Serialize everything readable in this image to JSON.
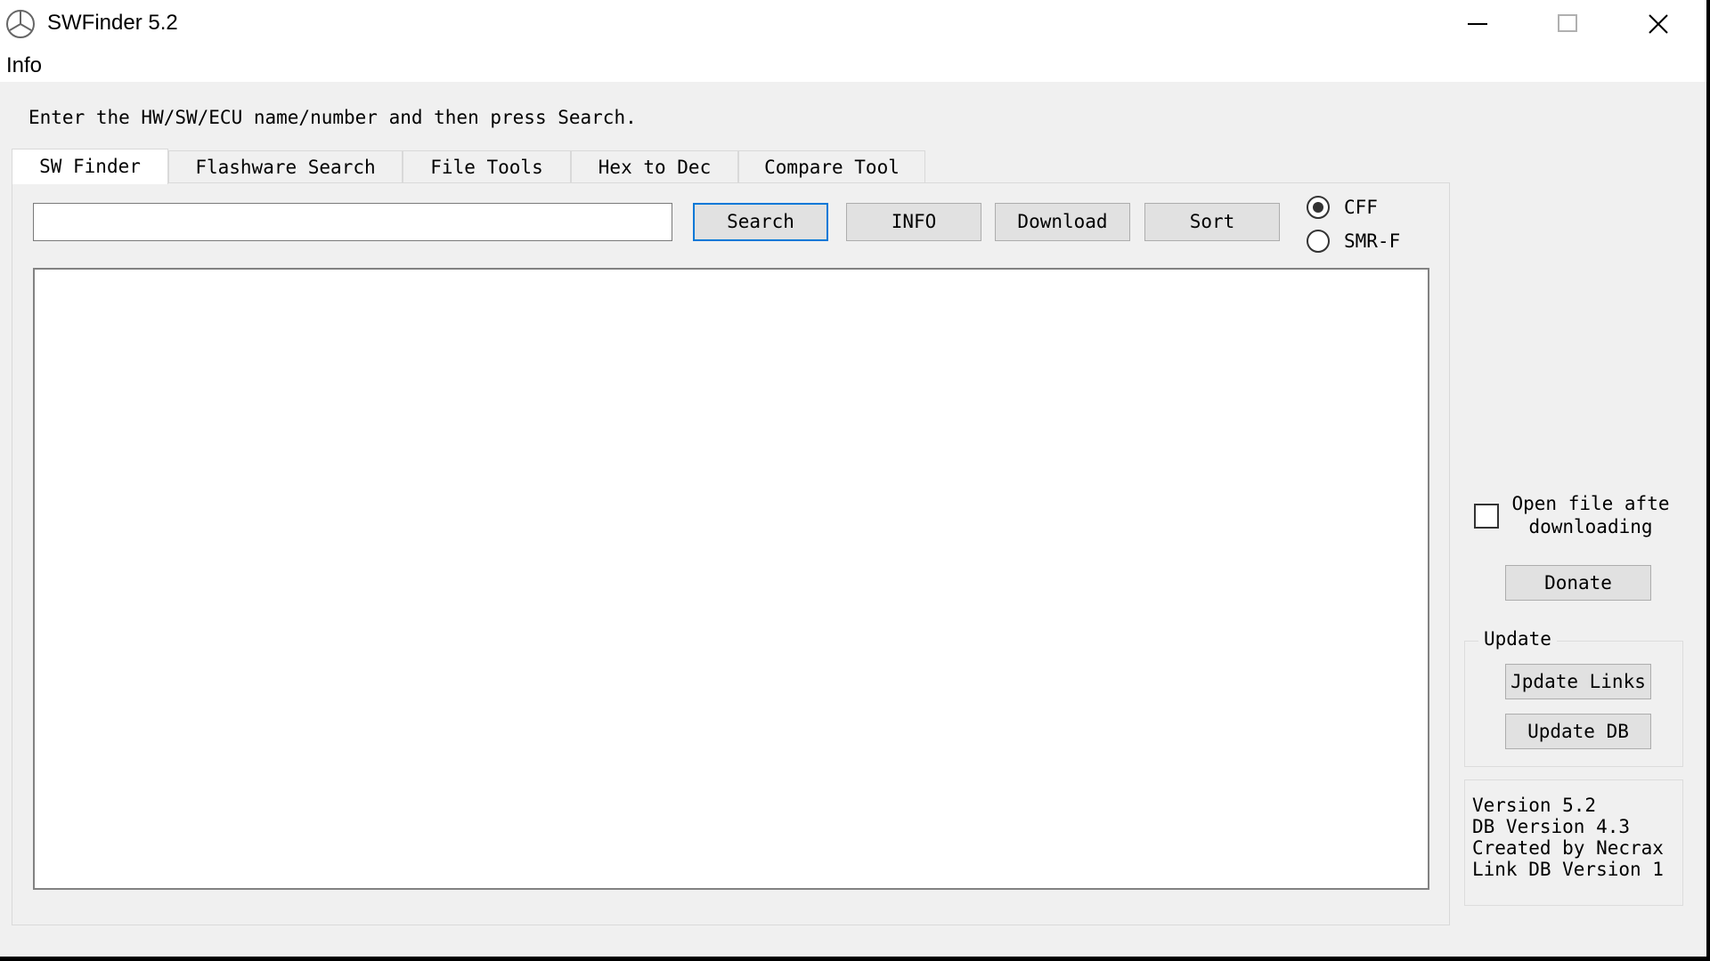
{
  "window": {
    "title": "SWFinder 5.2"
  },
  "menu": {
    "items": [
      "Info"
    ]
  },
  "instruction": "Enter the HW/SW/ECU name/number and then press Search.",
  "tabs": [
    {
      "label": "SW Finder",
      "active": true
    },
    {
      "label": "Flashware Search",
      "active": false
    },
    {
      "label": "File Tools",
      "active": false
    },
    {
      "label": "Hex to Dec",
      "active": false
    },
    {
      "label": "Compare Tool",
      "active": false
    }
  ],
  "search": {
    "value": "",
    "placeholder": ""
  },
  "buttons": {
    "search": "Search",
    "info": "INFO",
    "download": "Download",
    "sort": "Sort"
  },
  "format": {
    "options": [
      "CFF",
      "SMR-F"
    ],
    "selected": "CFF"
  },
  "options": {
    "open_after_download_line1": "Open file afte",
    "open_after_download_line2": "downloading",
    "checked": false
  },
  "donate": "Donate",
  "update": {
    "title": "Update",
    "links_button": "Jpdate Links",
    "db_button": "Update DB"
  },
  "version_info": [
    "Version 5.2",
    "DB Version 4.3",
    "Created by Necrax",
    "Link DB Version 1"
  ],
  "colors": {
    "accent": "#0078d7",
    "window_bg": "#f0f0f0",
    "titlebar_bg": "#ffffff"
  }
}
